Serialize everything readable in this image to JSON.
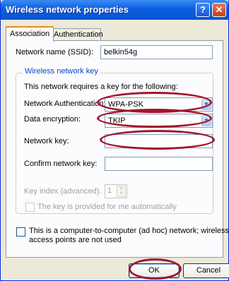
{
  "window": {
    "title": "Wireless network properties",
    "help_glyph": "?",
    "close_glyph": "✕"
  },
  "tabs": [
    {
      "label": "Association",
      "active": true
    },
    {
      "label": "Authentication",
      "active": false
    }
  ],
  "ssid": {
    "label": "Network name (SSID):",
    "value": "belkin54g"
  },
  "key_group": {
    "title": "Wireless network key",
    "intro": "This network requires a key for the following:",
    "auth_label": "Network Authentication:",
    "auth_value": "WPA-PSK",
    "enc_label": "Data encryption:",
    "enc_value": "TKIP",
    "key_label": "Network key:",
    "key_value": "",
    "confirm_label": "Confirm network key:",
    "confirm_value": "",
    "index_label": "Key index (advanced):",
    "index_value": "1",
    "auto_label": "The key is provided for me automatically"
  },
  "adhoc": {
    "line1": "This is a computer-to-computer (ad hoc) network; wireless",
    "line2": "access points are not used"
  },
  "buttons": {
    "ok": "OK",
    "cancel": "Cancel"
  },
  "colors": {
    "title_bar": "#0a5fe0",
    "highlight_ring": "#a0162d",
    "group_title": "#0046d5"
  }
}
